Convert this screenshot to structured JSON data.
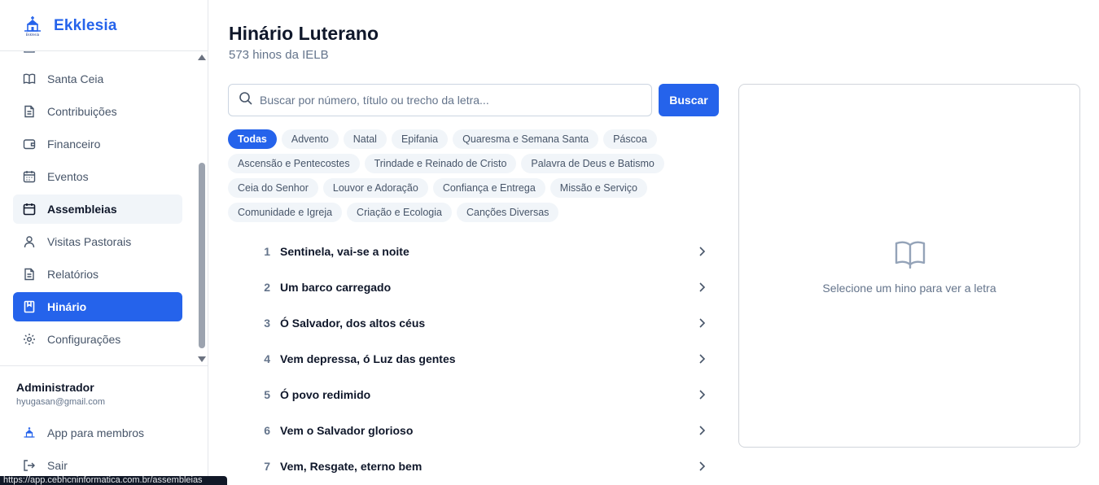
{
  "brand": {
    "name": "Ekklesia",
    "logo_icon": "church-icon",
    "accent": "#2563eb"
  },
  "sidebar": {
    "items": [
      {
        "label": "Santa Ceia",
        "icon": "book-open-icon",
        "state": "normal"
      },
      {
        "label": "Contribuições",
        "icon": "file-text-icon",
        "state": "normal"
      },
      {
        "label": "Financeiro",
        "icon": "wallet-icon",
        "state": "normal"
      },
      {
        "label": "Eventos",
        "icon": "calendar-grid-icon",
        "state": "normal"
      },
      {
        "label": "Assembleias",
        "icon": "calendar-icon",
        "state": "hover"
      },
      {
        "label": "Visitas Pastorais",
        "icon": "user-icon",
        "state": "normal"
      },
      {
        "label": "Relatórios",
        "icon": "file-text-icon",
        "state": "normal"
      },
      {
        "label": "Hinário",
        "icon": "book-bookmark-icon",
        "state": "active"
      },
      {
        "label": "Configurações",
        "icon": "gear-icon",
        "state": "normal"
      }
    ]
  },
  "user": {
    "name": "Administrador",
    "email": "hyugasan@gmail.com"
  },
  "footer": {
    "app_label": "App para membros",
    "logout_label": "Sair"
  },
  "statusbar": {
    "url": "https://app.cebhcninformatica.com.br/assembleias"
  },
  "main": {
    "title": "Hinário Luterano",
    "subtitle": "573 hinos da IELB",
    "search": {
      "placeholder": "Buscar por número, título ou trecho da letra...",
      "value": ""
    },
    "search_button": "Buscar",
    "categories": [
      [
        "Todas",
        "Advento",
        "Natal",
        "Epifania",
        "Quaresma e Semana Santa",
        "Páscoa"
      ],
      [
        "Ascensão e Pentecostes",
        "Trindade e Reinado de Cristo",
        "Palavra de Deus e Batismo"
      ],
      [
        "Ceia do Senhor",
        "Louvor e Adoração",
        "Confiança e Entrega",
        "Missão e Serviço"
      ],
      [
        "Comunidade e Igreja",
        "Criação e Ecologia",
        "Canções Diversas"
      ]
    ],
    "active_category": "Todas",
    "hymns": [
      {
        "number": "1",
        "title": "Sentinela, vai-se a noite"
      },
      {
        "number": "2",
        "title": "Um barco carregado"
      },
      {
        "number": "3",
        "title": "Ó Salvador, dos altos céus"
      },
      {
        "number": "4",
        "title": "Vem depressa, ó Luz das gentes"
      },
      {
        "number": "5",
        "title": "Ó povo redimido"
      },
      {
        "number": "6",
        "title": "Vem o Salvador glorioso"
      },
      {
        "number": "7",
        "title": "Vem, Resgate, eterno bem"
      }
    ]
  },
  "panel": {
    "empty_text": "Selecione um hino para ver a letra",
    "icon": "book-open-icon"
  }
}
